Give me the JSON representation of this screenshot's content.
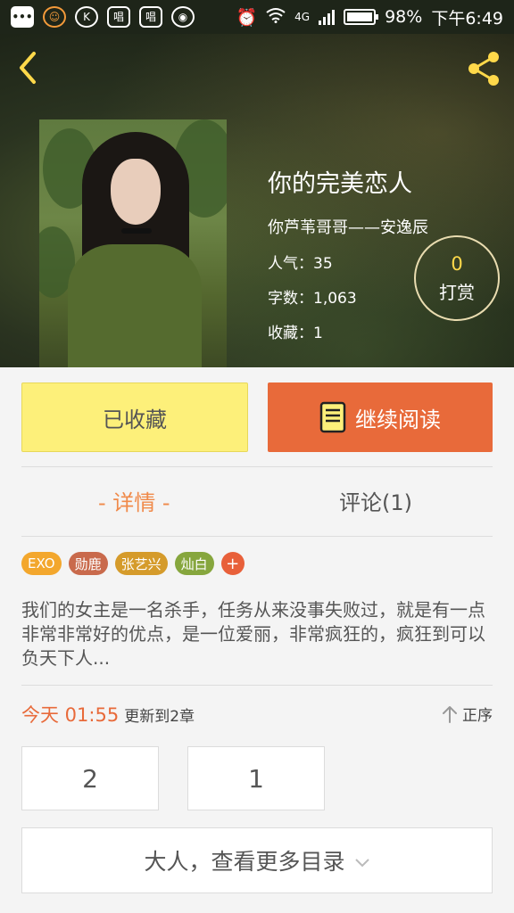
{
  "status_bar": {
    "network": "4G",
    "battery": "98%",
    "time": "下午6:49",
    "battery_level": 0.98
  },
  "book": {
    "title": "你的完美恋人",
    "author": "你芦苇哥哥——安逸辰",
    "popularity": "人气：35",
    "word_count": "字数：1,063",
    "favorites": "收藏：1"
  },
  "reward": {
    "count": "0",
    "label": "打赏"
  },
  "actions": {
    "collected_label": "已收藏",
    "read_label": "继续阅读"
  },
  "tabs": {
    "detail": "- 详情 -",
    "comments": "评论(1)"
  },
  "tags": [
    {
      "label": "EXO",
      "color": "#f3a72d"
    },
    {
      "label": "勋鹿",
      "color": "#c96a4c"
    },
    {
      "label": "张艺兴",
      "color": "#d59b2b"
    },
    {
      "label": "灿白",
      "color": "#86a63d"
    }
  ],
  "tag_add": "+",
  "description": "我们的女主是一名杀手，任务从来没事失败过，就是有一点非常非常好的优点，是一位爱丽，非常疯狂的，疯狂到可以负天下人...",
  "update": {
    "time": "今天 01:55",
    "text": "更新到2章",
    "sort_label": "正序"
  },
  "chapters": [
    "2",
    "1"
  ],
  "more_label": "大人，查看更多目录",
  "colors": {
    "accent": "#e86a3a",
    "collected_bg": "#fdf07a",
    "tab_active": "#f08a4a",
    "reward_count": "#ffd94a"
  },
  "icons": {
    "back": "back-arrow-icon",
    "share": "share-icon",
    "book": "book-icon",
    "sort": "arrow-up-icon",
    "expand": "chevron-down-icon"
  }
}
